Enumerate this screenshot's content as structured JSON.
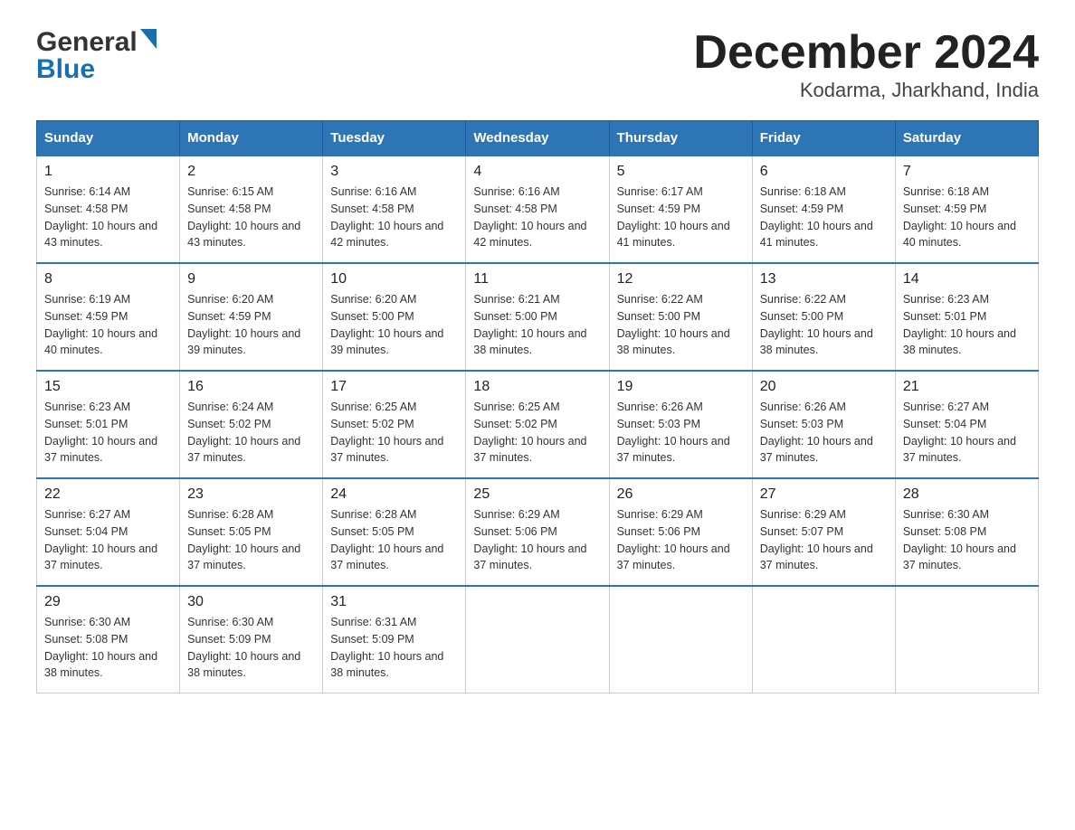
{
  "header": {
    "logo_general": "General",
    "logo_blue": "Blue",
    "title": "December 2024",
    "subtitle": "Kodarma, Jharkhand, India"
  },
  "calendar": {
    "days_of_week": [
      "Sunday",
      "Monday",
      "Tuesday",
      "Wednesday",
      "Thursday",
      "Friday",
      "Saturday"
    ],
    "weeks": [
      [
        {
          "day": "1",
          "sunrise": "6:14 AM",
          "sunset": "4:58 PM",
          "daylight": "10 hours and 43 minutes."
        },
        {
          "day": "2",
          "sunrise": "6:15 AM",
          "sunset": "4:58 PM",
          "daylight": "10 hours and 43 minutes."
        },
        {
          "day": "3",
          "sunrise": "6:16 AM",
          "sunset": "4:58 PM",
          "daylight": "10 hours and 42 minutes."
        },
        {
          "day": "4",
          "sunrise": "6:16 AM",
          "sunset": "4:58 PM",
          "daylight": "10 hours and 42 minutes."
        },
        {
          "day": "5",
          "sunrise": "6:17 AM",
          "sunset": "4:59 PM",
          "daylight": "10 hours and 41 minutes."
        },
        {
          "day": "6",
          "sunrise": "6:18 AM",
          "sunset": "4:59 PM",
          "daylight": "10 hours and 41 minutes."
        },
        {
          "day": "7",
          "sunrise": "6:18 AM",
          "sunset": "4:59 PM",
          "daylight": "10 hours and 40 minutes."
        }
      ],
      [
        {
          "day": "8",
          "sunrise": "6:19 AM",
          "sunset": "4:59 PM",
          "daylight": "10 hours and 40 minutes."
        },
        {
          "day": "9",
          "sunrise": "6:20 AM",
          "sunset": "4:59 PM",
          "daylight": "10 hours and 39 minutes."
        },
        {
          "day": "10",
          "sunrise": "6:20 AM",
          "sunset": "5:00 PM",
          "daylight": "10 hours and 39 minutes."
        },
        {
          "day": "11",
          "sunrise": "6:21 AM",
          "sunset": "5:00 PM",
          "daylight": "10 hours and 38 minutes."
        },
        {
          "day": "12",
          "sunrise": "6:22 AM",
          "sunset": "5:00 PM",
          "daylight": "10 hours and 38 minutes."
        },
        {
          "day": "13",
          "sunrise": "6:22 AM",
          "sunset": "5:00 PM",
          "daylight": "10 hours and 38 minutes."
        },
        {
          "day": "14",
          "sunrise": "6:23 AM",
          "sunset": "5:01 PM",
          "daylight": "10 hours and 38 minutes."
        }
      ],
      [
        {
          "day": "15",
          "sunrise": "6:23 AM",
          "sunset": "5:01 PM",
          "daylight": "10 hours and 37 minutes."
        },
        {
          "day": "16",
          "sunrise": "6:24 AM",
          "sunset": "5:02 PM",
          "daylight": "10 hours and 37 minutes."
        },
        {
          "day": "17",
          "sunrise": "6:25 AM",
          "sunset": "5:02 PM",
          "daylight": "10 hours and 37 minutes."
        },
        {
          "day": "18",
          "sunrise": "6:25 AM",
          "sunset": "5:02 PM",
          "daylight": "10 hours and 37 minutes."
        },
        {
          "day": "19",
          "sunrise": "6:26 AM",
          "sunset": "5:03 PM",
          "daylight": "10 hours and 37 minutes."
        },
        {
          "day": "20",
          "sunrise": "6:26 AM",
          "sunset": "5:03 PM",
          "daylight": "10 hours and 37 minutes."
        },
        {
          "day": "21",
          "sunrise": "6:27 AM",
          "sunset": "5:04 PM",
          "daylight": "10 hours and 37 minutes."
        }
      ],
      [
        {
          "day": "22",
          "sunrise": "6:27 AM",
          "sunset": "5:04 PM",
          "daylight": "10 hours and 37 minutes."
        },
        {
          "day": "23",
          "sunrise": "6:28 AM",
          "sunset": "5:05 PM",
          "daylight": "10 hours and 37 minutes."
        },
        {
          "day": "24",
          "sunrise": "6:28 AM",
          "sunset": "5:05 PM",
          "daylight": "10 hours and 37 minutes."
        },
        {
          "day": "25",
          "sunrise": "6:29 AM",
          "sunset": "5:06 PM",
          "daylight": "10 hours and 37 minutes."
        },
        {
          "day": "26",
          "sunrise": "6:29 AM",
          "sunset": "5:06 PM",
          "daylight": "10 hours and 37 minutes."
        },
        {
          "day": "27",
          "sunrise": "6:29 AM",
          "sunset": "5:07 PM",
          "daylight": "10 hours and 37 minutes."
        },
        {
          "day": "28",
          "sunrise": "6:30 AM",
          "sunset": "5:08 PM",
          "daylight": "10 hours and 37 minutes."
        }
      ],
      [
        {
          "day": "29",
          "sunrise": "6:30 AM",
          "sunset": "5:08 PM",
          "daylight": "10 hours and 38 minutes."
        },
        {
          "day": "30",
          "sunrise": "6:30 AM",
          "sunset": "5:09 PM",
          "daylight": "10 hours and 38 minutes."
        },
        {
          "day": "31",
          "sunrise": "6:31 AM",
          "sunset": "5:09 PM",
          "daylight": "10 hours and 38 minutes."
        },
        {
          "day": "",
          "sunrise": "",
          "sunset": "",
          "daylight": ""
        },
        {
          "day": "",
          "sunrise": "",
          "sunset": "",
          "daylight": ""
        },
        {
          "day": "",
          "sunrise": "",
          "sunset": "",
          "daylight": ""
        },
        {
          "day": "",
          "sunrise": "",
          "sunset": "",
          "daylight": ""
        }
      ]
    ],
    "labels": {
      "sunrise": "Sunrise:",
      "sunset": "Sunset:",
      "daylight": "Daylight:"
    }
  }
}
